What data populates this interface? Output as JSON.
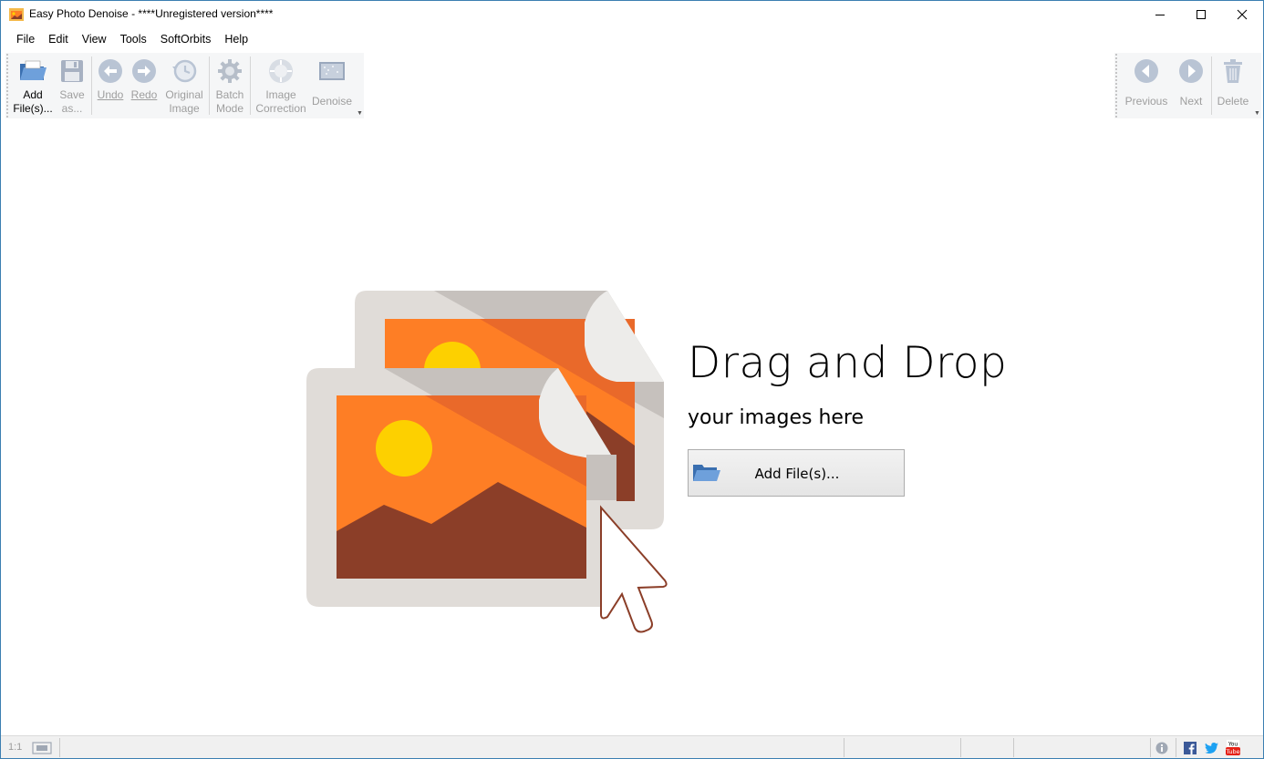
{
  "window": {
    "title": "Easy Photo Denoise - ****Unregistered version****"
  },
  "menu": [
    {
      "label": "File",
      "name": "menu-file"
    },
    {
      "label": "Edit",
      "name": "menu-edit"
    },
    {
      "label": "View",
      "name": "menu-view"
    },
    {
      "label": "Tools",
      "name": "menu-tools"
    },
    {
      "label": "SoftOrbits",
      "name": "menu-softorbits"
    },
    {
      "label": "Help",
      "name": "menu-help"
    }
  ],
  "toolbar": {
    "add_files": "Add\nFile(s)...",
    "save_as": "Save\nas...",
    "undo": "Undo",
    "redo": "Redo",
    "original_image": "Original\nImage",
    "batch_mode": "Batch\nMode",
    "image_correction": "Image\nCorrection",
    "denoise": "Denoise",
    "previous": "Previous",
    "next": "Next",
    "delete": "Delete"
  },
  "drop_zone": {
    "title": "Drag and Drop",
    "subtitle": "your images here",
    "button_label": "Add File(s)..."
  },
  "statusbar": {
    "zoom_label": "1:1"
  },
  "colors": {
    "orange": "#fe7e25",
    "dark_orange": "#e9692a",
    "brown": "#8b3e28",
    "sun": "#fdd000",
    "frame": "#e0dcd8",
    "toolbar_bg": "#f5f6f7",
    "disabled_text": "#9e9e9e"
  }
}
